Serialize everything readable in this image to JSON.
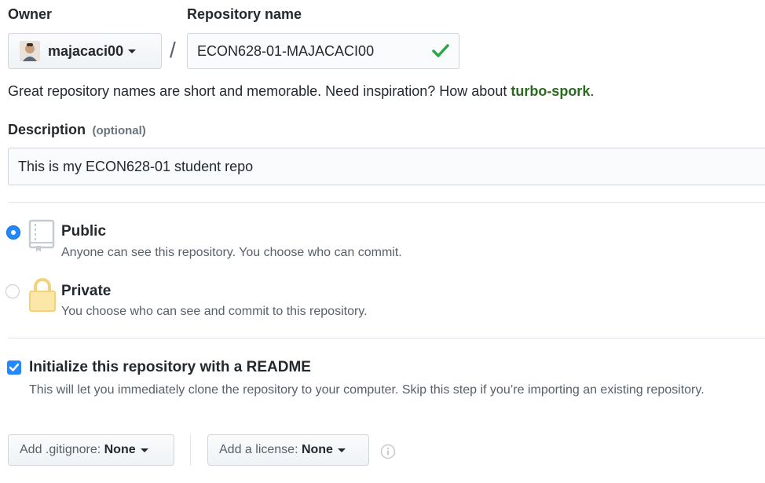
{
  "owner": {
    "label": "Owner",
    "value": "majacaci00"
  },
  "separator": "/",
  "repo_name": {
    "label": "Repository name",
    "value": "ECON628-01-MAJACACI00",
    "valid_icon": "check-icon"
  },
  "hint": {
    "prefix": "Great repository names are short and memorable. Need inspiration? How about ",
    "suggestion": "turbo-spork",
    "suffix": "."
  },
  "description": {
    "label": "Description",
    "optional": "(optional)",
    "value": "This is my ECON628-01 student repo"
  },
  "visibility": {
    "public": {
      "title": "Public",
      "desc": "Anyone can see this repository. You choose who can commit.",
      "selected": true,
      "icon": "repo-book-icon"
    },
    "private": {
      "title": "Private",
      "desc": "You choose who can see and commit to this repository.",
      "selected": false,
      "icon": "lock-icon"
    }
  },
  "readme": {
    "label": "Initialize this repository with a README",
    "desc": "This will let you immediately clone the repository to your computer. Skip this step if you’re importing an existing repository.",
    "checked": true
  },
  "gitignore": {
    "prefix": "Add .gitignore: ",
    "value": "None"
  },
  "license": {
    "prefix": "Add a license: ",
    "value": "None"
  },
  "info_icon": "info-icon",
  "colors": {
    "accent": "#2188ff",
    "suggestion": "#2b6a1e",
    "check": "#28a745",
    "lock": "#f3d27b"
  }
}
